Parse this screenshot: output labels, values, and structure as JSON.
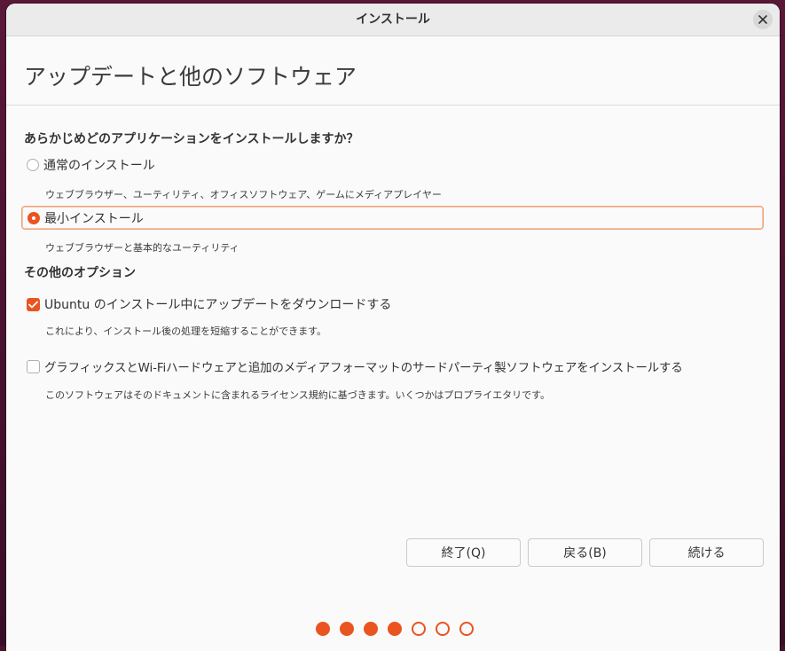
{
  "window": {
    "title": "インストール"
  },
  "header": {
    "title": "アップデートと他のソフトウェア"
  },
  "apps_section": {
    "heading": "あらかじめどのアプリケーションをインストールしますか？",
    "options": [
      {
        "label": "通常のインストール",
        "description": "ウェブブラウザー、ユーティリティ、オフィスソフトウェア、ゲームにメディアプレイヤー",
        "selected": false
      },
      {
        "label": "最小インストール",
        "description": "ウェブブラウザーと基本的なユーティリティ",
        "selected": true
      }
    ]
  },
  "other_section": {
    "heading": "その他のオプション",
    "options": [
      {
        "label": "Ubuntu のインストール中にアップデートをダウンロードする",
        "description": "これにより、インストール後の処理を短縮することができます。",
        "checked": true
      },
      {
        "label": "グラフィックスとWi-Fiハードウェアと追加のメディアフォーマットのサードパーティ製ソフトウェアをインストールする",
        "description": "このソフトウェアはそのドキュメントに含まれるライセンス規約に基づきます。いくつかはプロプライエタリです。",
        "checked": false
      }
    ]
  },
  "buttons": {
    "quit": "終了(Q)",
    "back": "戻る(B)",
    "continue": "続ける"
  },
  "progress": {
    "total_steps": 7,
    "completed_steps": 4
  },
  "colors": {
    "accent": "#e95420"
  }
}
